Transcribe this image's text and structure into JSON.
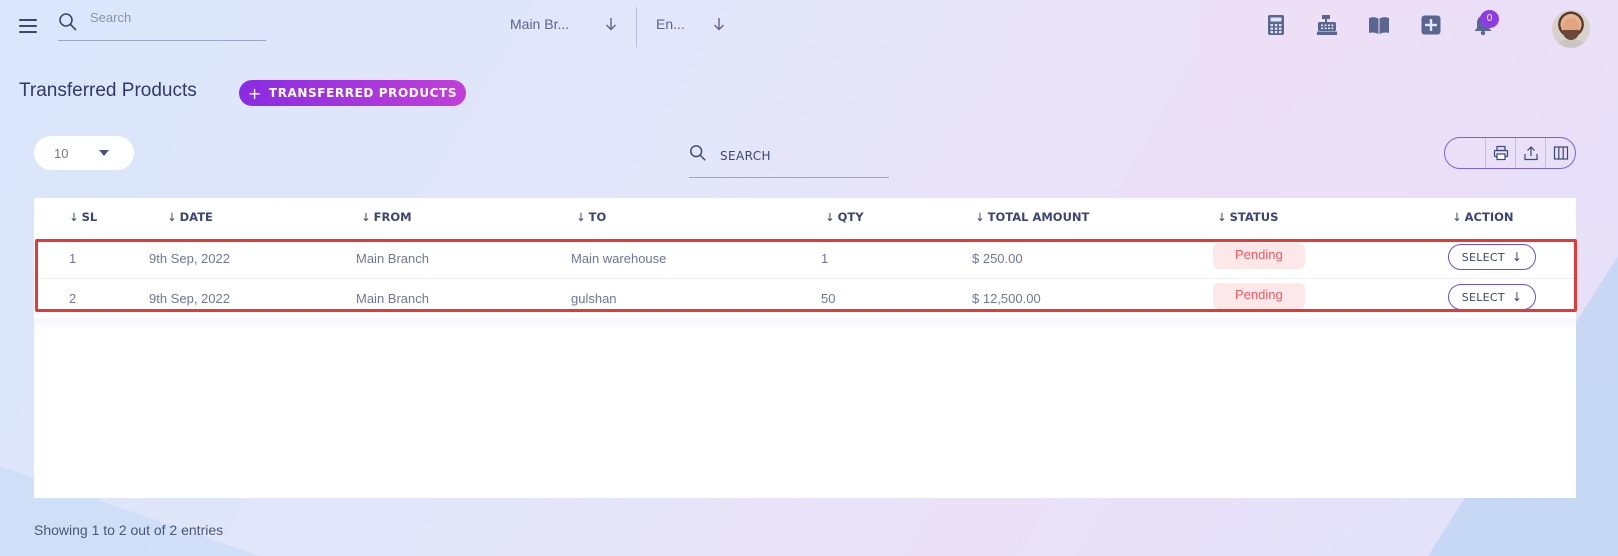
{
  "topbar": {
    "search_placeholder": "Search",
    "branch": "Main Br...",
    "language": "En...",
    "notification_count": "0",
    "icons": [
      "calculator-icon",
      "cash-register-icon",
      "book-icon",
      "plus-square-icon",
      "bell-icon"
    ]
  },
  "page": {
    "title": "Transferred Products",
    "add_button_label": "TRANSFERRED PRODUCTS"
  },
  "controls": {
    "per_page": "10",
    "search_placeholder": "SEARCH",
    "tools": [
      "print-icon",
      "export-icon",
      "columns-icon"
    ]
  },
  "table": {
    "columns": [
      "SL",
      "DATE",
      "FROM",
      "TO",
      "QTY",
      "TOTAL AMOUNT",
      "STATUS",
      "ACTION"
    ],
    "rows": [
      {
        "sl": "1",
        "date": "9th Sep, 2022",
        "from": "Main Branch",
        "to": "Main warehouse",
        "qty": "1",
        "total": "$ 250.00",
        "status": "Pending",
        "action": "SELECT"
      },
      {
        "sl": "2",
        "date": "9th Sep, 2022",
        "from": "Main Branch",
        "to": "gulshan",
        "qty": "50",
        "total": "$ 12,500.00",
        "status": "Pending",
        "action": "SELECT"
      }
    ]
  },
  "footer": {
    "info": "Showing 1 to 2 out of 2 entries"
  },
  "colors": {
    "accent": "#8a2be2",
    "status_pending_bg": "#fde8e9",
    "status_pending_text": "#ef5b62",
    "highlight": "#e53935"
  }
}
